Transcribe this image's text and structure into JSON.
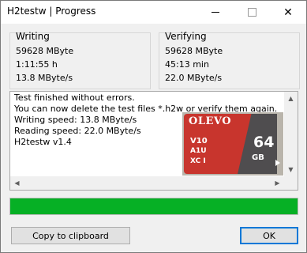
{
  "window": {
    "title": "H2testw | Progress"
  },
  "writing": {
    "label": "Writing",
    "size": "59628 MByte",
    "time": "1:11:55 h",
    "speed": "13.8 MByte/s"
  },
  "verifying": {
    "label": "Verifying",
    "size": "59628 MByte",
    "time": "45:13 min",
    "speed": "22.0 MByte/s"
  },
  "log": {
    "lines": [
      "Test finished without errors.",
      "You can now delete the test files *.h2w or verify them again.",
      "Writing speed: 13.8 MByte/s",
      "Reading speed: 22.0 MByte/s",
      "H2testw v1.4"
    ]
  },
  "card": {
    "brand": "OLEVO",
    "speed_class": "V10",
    "uhs_class": "A1U",
    "type": "XC I",
    "capacity": "64",
    "unit": "GB"
  },
  "progress": {
    "fraction": 1.0,
    "color": "#06b025"
  },
  "buttons": {
    "copy": "Copy to clipboard",
    "ok": "OK"
  }
}
